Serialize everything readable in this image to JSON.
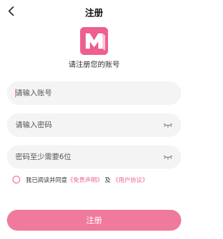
{
  "header": {
    "back_icon": "chevron-left-icon",
    "title": "注册"
  },
  "brand": {
    "logo_icon": "m-logo-icon",
    "logo_color": "#ee5f8e",
    "subtitle": "请注册您的账号"
  },
  "form": {
    "account": {
      "value": "",
      "placeholder": "请输入账号"
    },
    "password": {
      "value": "",
      "placeholder": "请输入密码",
      "icon": "eye-closed-icon"
    },
    "confirm": {
      "value": "",
      "placeholder": "密码至少需要6位",
      "icon": "eye-closed-icon"
    }
  },
  "agreement": {
    "prefix": "我已阅读并同意",
    "disclaimer_link": "《免责声明》",
    "and": "及",
    "user_agreement_link": "《用户协议》",
    "checked": false
  },
  "submit_label": "注册",
  "colors": {
    "accent": "#ee5f8e",
    "button": "#f07a9c",
    "field_bg": "#f4f4f4"
  }
}
